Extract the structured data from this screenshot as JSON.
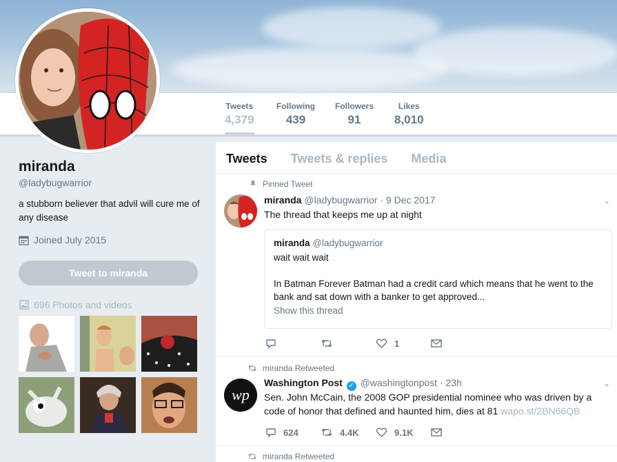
{
  "profile": {
    "name": "miranda",
    "handle": "@ladybugwarrior",
    "bio": "a stubborn believer that advil will cure me of any disease",
    "joined": "Joined July 2015",
    "tweet_to_label": "Tweet to miranda",
    "photos_label": "696 Photos and videos"
  },
  "stats": [
    {
      "label": "Tweets",
      "value": "4,379"
    },
    {
      "label": "Following",
      "value": "439"
    },
    {
      "label": "Followers",
      "value": "91"
    },
    {
      "label": "Likes",
      "value": "8,010"
    }
  ],
  "tabs": [
    "Tweets",
    "Tweets & replies",
    "Media"
  ],
  "tweets": [
    {
      "context": "Pinned Tweet",
      "name": "miranda",
      "meta": "@ladybugwarrior · 9 Dec 2017",
      "text": "The thread that keeps me up at night",
      "quote": {
        "name": "miranda",
        "handle": "@ladybugwarrior",
        "line1": "wait wait wait",
        "line2": "In Batman Forever Batman had a credit card which means that he went to the bank and sat down with a banker to get approved...",
        "show": "Show this thread"
      },
      "replies": "",
      "retweets": "",
      "likes": "1"
    },
    {
      "context": "miranda Retweeted",
      "name": "Washington Post",
      "meta": "@washingtonpost · 23h",
      "text": "Sen. John McCain, the 2008 GOP presidential nominee who was driven by a code of honor that defined and haunted him, dies at 81",
      "link": "wapo.st/2BN66QB",
      "replies": "624",
      "retweets": "4.4K",
      "likes": "9.1K"
    },
    {
      "context": "miranda Retweeted"
    }
  ],
  "colors": {
    "accent": "#1da1f2",
    "muted": "#657786",
    "light": "#aab8c2"
  }
}
